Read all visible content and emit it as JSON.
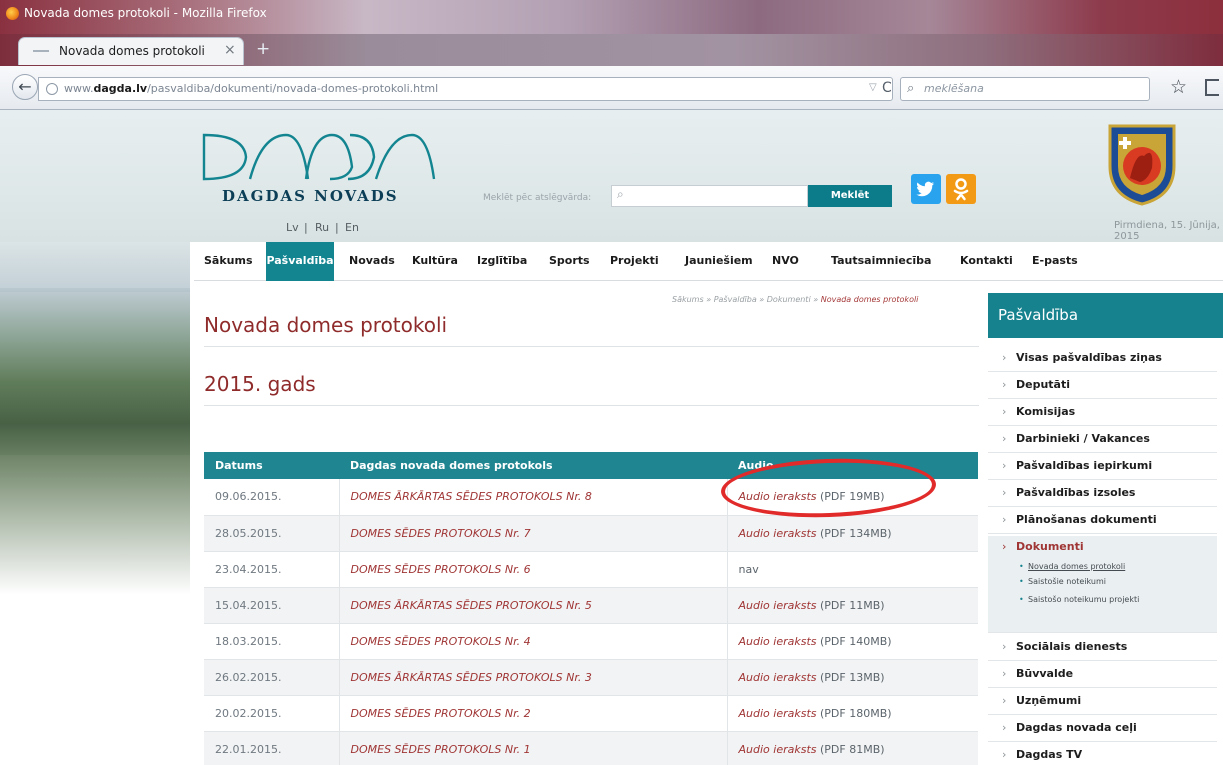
{
  "browser": {
    "window_title": "Novada domes protokoli - Mozilla Firefox",
    "tab_title": "Novada domes protokoli",
    "tab_close": "×",
    "new_tab": "+",
    "url_prefix": "www.",
    "url_domain": "dagda.lv",
    "url_path": "/pasvaldiba/dokumenti/novada-domes-protokoli.html",
    "search_placeholder": "meklēšana"
  },
  "header": {
    "brand": "DAGDAS NOVADS",
    "languages": [
      "Lv",
      "Ru",
      "En"
    ],
    "lang_separator": "|",
    "keyword_label": "Meklēt pēc atslēgvārda:",
    "search_button": "Meklēt",
    "date": "Pirmdiena, 15. Jūnija, 2015"
  },
  "nav": {
    "items": [
      "Sākums",
      "Pašvaldība",
      "Novads",
      "Kultūra",
      "Izglītība",
      "Sports",
      "Projekti",
      "Jauniešiem",
      "NVO",
      "Tautsaimniecība",
      "Kontakti",
      "E-pasts"
    ],
    "active": "Pašvaldība"
  },
  "breadcrumb": {
    "items": [
      "Sākums",
      "Pašvaldība",
      "Dokumenti"
    ],
    "current": "Novada domes protokoli",
    "separator": "»"
  },
  "content": {
    "title": "Novada domes protokoli",
    "year_heading": "2015. gads"
  },
  "table": {
    "headers": [
      "Datums",
      "Dagdas novada domes protokols",
      "Audio"
    ],
    "rows": [
      {
        "date": "09.06.2015.",
        "protocol": "DOMES ĀRKĀRTAS SĒDES PROTOKOLS Nr. 8",
        "audio_link": "Audio ieraksts",
        "audio_info": " (PDF 19MB)"
      },
      {
        "date": "28.05.2015.",
        "protocol": "DOMES SĒDES PROTOKOLS Nr. 7",
        "audio_link": "Audio ieraksts",
        "audio_info": " (PDF 134MB)"
      },
      {
        "date": "23.04.2015.",
        "protocol": "DOMES SĒDES PROTOKOLS Nr. 6",
        "audio_link": "",
        "audio_info": "nav"
      },
      {
        "date": "15.04.2015.",
        "protocol": "DOMES ĀRKĀRTAS SĒDES PROTOKOLS Nr. 5",
        "audio_link": "Audio ieraksts",
        "audio_info": " (PDF 11MB)"
      },
      {
        "date": "18.03.2015.",
        "protocol": "DOMES SĒDES PROTOKOLS Nr. 4",
        "audio_link": "Audio ieraksts",
        "audio_info": " (PDF 140MB)"
      },
      {
        "date": "26.02.2015.",
        "protocol": "DOMES ĀRKĀRTAS SĒDES PROTOKOLS Nr. 3",
        "audio_link": "Audio ieraksts",
        "audio_info": " (PDF 13MB)"
      },
      {
        "date": "20.02.2015.",
        "protocol": "DOMES SĒDES PROTOKOLS Nr. 2",
        "audio_link": "Audio ieraksts",
        "audio_info": " (PDF 180MB)"
      },
      {
        "date": "22.01.2015.",
        "protocol": "DOMES SĒDES PROTOKOLS Nr. 1",
        "audio_link": "Audio ieraksts",
        "audio_info": " (PDF 81MB)"
      }
    ]
  },
  "sidebar": {
    "title": "Pašvaldība",
    "arrow": "›",
    "bullet": "•",
    "items_before": [
      "Visas pašvaldības ziņas",
      "Deputāti",
      "Komisijas",
      "Darbinieki / Vakances",
      "Pašvaldības iepirkumi",
      "Pašvaldības izsoles",
      "Plānošanas dokumenti"
    ],
    "active_item": "Dokumenti",
    "sub_items": [
      "Novada domes protokoli",
      "Saistošie noteikumi",
      "Saistošo noteikumu projekti"
    ],
    "items_after": [
      "Sociālais dienests",
      "Būvvalde",
      "Uzņēmumi",
      "Dagdas novada ceļi",
      "Dagdas TV"
    ]
  },
  "colors": {
    "teal": "#138591",
    "dark_red_title": "#8f2b2b",
    "link_red": "#a03535",
    "annotation_red": "#e12a2a"
  }
}
